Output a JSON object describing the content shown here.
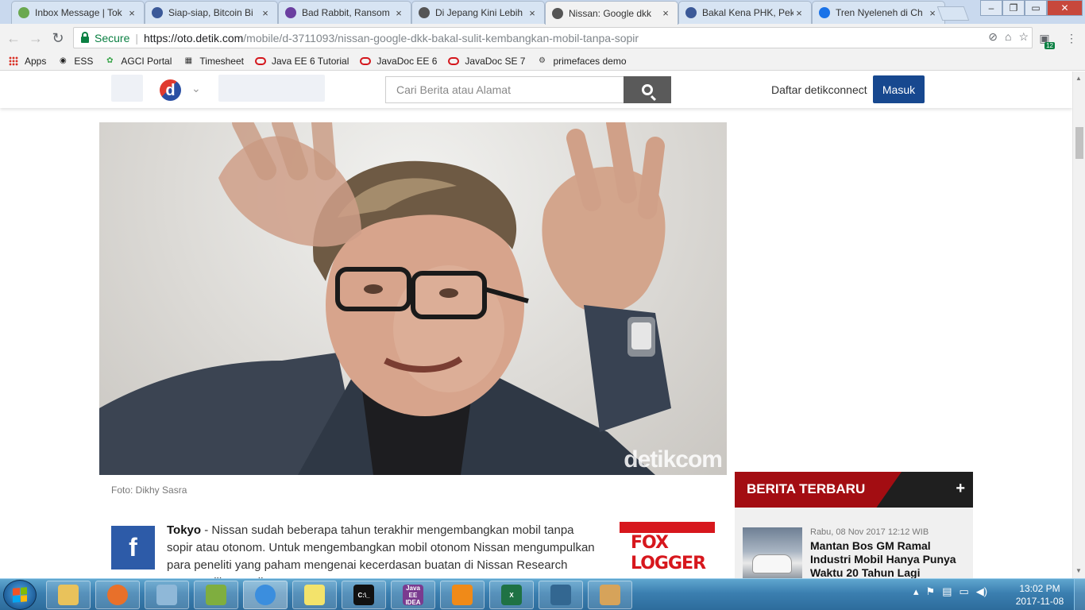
{
  "browser": {
    "tabs": [
      {
        "title": "Inbox Message | Tok",
        "icon": "inbox-icon",
        "color": "#6aa84f"
      },
      {
        "title": "Siap-siap, Bitcoin Bi",
        "icon": "facebook-icon",
        "color": "#3b5998"
      },
      {
        "title": "Bad Rabbit, Ransom",
        "icon": "yahoo-icon",
        "color": "#6b3fa0"
      },
      {
        "title": "Di Jepang Kini Lebih",
        "icon": "detik-icon",
        "color": "#555555"
      },
      {
        "title": "Nissan: Google dkk",
        "icon": "detik-icon",
        "color": "#555555",
        "active": true
      },
      {
        "title": "Bakal Kena PHK, Pek",
        "icon": "facebook-icon",
        "color": "#3b5998"
      },
      {
        "title": "Tren Nyeleneh di Ch",
        "icon": "runner-icon",
        "color": "#1a73e8"
      }
    ],
    "close_glyph": "×",
    "secure_label": "Secure",
    "url_scheme_host": "https://oto.detik.com",
    "url_path": "/mobile/d-3711093/nissan-google-dkk-bakal-sulit-kembangkan-mobil-tanpa-sopir",
    "extension_badge": "12",
    "bookmarks": [
      {
        "label": "Apps",
        "icon": "apps-grid-icon"
      },
      {
        "label": "ESS",
        "icon": "ess-icon"
      },
      {
        "label": "AGCI Portal",
        "icon": "agci-icon"
      },
      {
        "label": "Timesheet",
        "icon": "timesheet-icon"
      },
      {
        "label": "Java EE 6 Tutorial",
        "icon": "oracle-icon"
      },
      {
        "label": "JavaDoc EE 6",
        "icon": "oracle-icon"
      },
      {
        "label": "JavaDoc SE 7",
        "icon": "oracle-icon"
      },
      {
        "label": "primefaces demo",
        "icon": "primefaces-icon"
      }
    ]
  },
  "site": {
    "logo_letter": "d",
    "search_placeholder": "Cari Berita atau Alamat",
    "daftar_label": "Daftar detikconnect",
    "masuk_label": "Masuk",
    "photo_watermark": "detikcom",
    "photo_credit": "Foto: Dikhy Sasra",
    "article_city": "Tokyo",
    "article_body": " - Nissan sudah beberapa tahun terakhir mengembangkan mobil tanpa sopir atau otonom. Untuk mengembangkan mobil otonom Nissan mengumpulkan para peneliti yang paham mengenai kecerdasan buatan di Nissan Research Center Silicon Valley.",
    "ad_text": "FOX LOGGER",
    "berita_title": "BERITA TERBARU",
    "berita_plus": "+",
    "news_item": {
      "date": "Rabu, 08 Nov 2017 12:12 WIB",
      "headline": "Mantan Bos GM Ramal Industri Mobil Hanya Punya Waktu 20 Tahun Lagi"
    },
    "colors": {
      "brand_blue": "#17488f",
      "berita_red": "#a30d12",
      "facebook": "#2d5ba8"
    }
  },
  "taskbar": {
    "apps": [
      {
        "name": "explorer",
        "icon": "folder-icon",
        "color": "#e9c25b",
        "label": ""
      },
      {
        "name": "firefox",
        "icon": "firefox-icon",
        "color": "#e8702a",
        "label": ""
      },
      {
        "name": "notepad",
        "icon": "notepad-icon",
        "color": "#8fb8d8",
        "label": ""
      },
      {
        "name": "chart-tool",
        "icon": "chart-app-icon",
        "color": "#7fae3f",
        "label": ""
      },
      {
        "name": "chrome",
        "icon": "chrome-icon",
        "color": "#3b8ede",
        "label": ""
      },
      {
        "name": "sticky-notes",
        "icon": "sticky-notes-icon",
        "color": "#f3e36b",
        "label": ""
      },
      {
        "name": "cmd",
        "icon": "terminal-icon",
        "color": "#111111",
        "label": "C:\\_"
      },
      {
        "name": "intellij",
        "icon": "java-ide-icon",
        "color": "#7a3b8f",
        "label": "Java EE IDEA"
      },
      {
        "name": "vlc",
        "icon": "vlc-icon",
        "color": "#f08a18",
        "label": ""
      },
      {
        "name": "excel",
        "icon": "excel-icon",
        "color": "#1f7244",
        "label": "X"
      },
      {
        "name": "postgres",
        "icon": "postgres-icon",
        "color": "#336791",
        "label": ""
      },
      {
        "name": "paint",
        "icon": "paint-icon",
        "color": "#d6a35a",
        "label": ""
      }
    ],
    "time": "13:02 PM",
    "date": "2017-11-08"
  }
}
